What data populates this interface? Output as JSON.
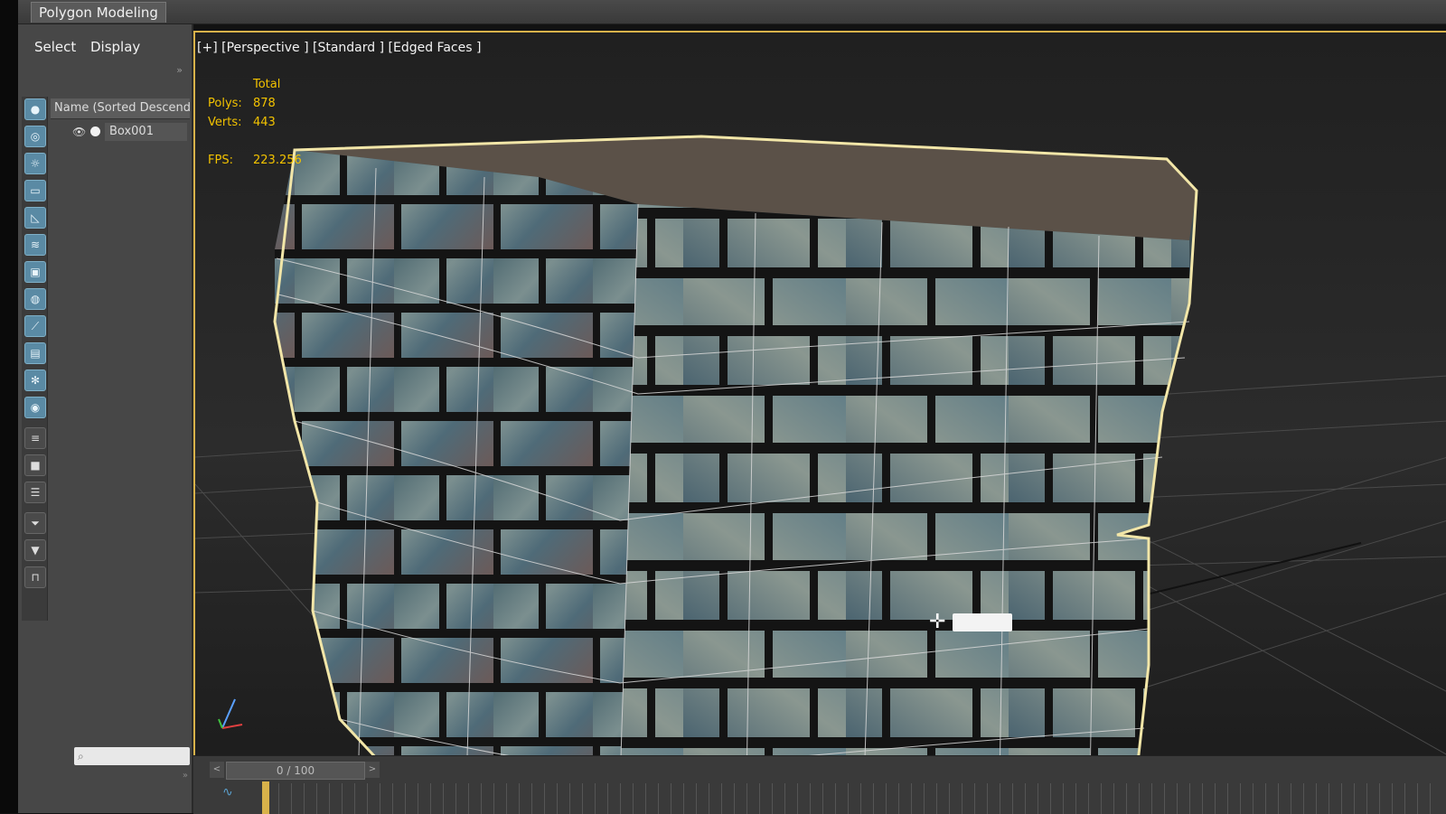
{
  "ribbon": {
    "active_tab": "Polygon Modeling"
  },
  "explorer": {
    "menu": [
      "Select",
      "Display"
    ],
    "collapse": "»",
    "column_header": "Name (Sorted Descendin",
    "objects": [
      {
        "name": "Box001",
        "visible": true
      }
    ],
    "footer_arrows": "»",
    "tool_icons": [
      "sphere-filter-icon",
      "geometry-icon",
      "light-icon",
      "camera-icon",
      "helper-icon",
      "spacewarp-icon",
      "group-icon",
      "xref-icon",
      "bone-icon",
      "container-icon",
      "frozen-icon",
      "hidden-icon",
      "list-icon",
      "select-all-icon",
      "properties-icon",
      "filter-icon",
      "funnel-icon",
      "layer-icon"
    ]
  },
  "viewport": {
    "label": "[+] [Perspective ] [Standard ] [Edged Faces ]",
    "stats": {
      "header": "Total",
      "polys_label": "Polys:",
      "polys": "878",
      "verts_label": "Verts:",
      "verts": "443",
      "fps_label": "FPS:",
      "fps": "223.256"
    },
    "selection_color": "#d8b24a"
  },
  "timeline": {
    "frame_display": "0 / 100",
    "prev": "<",
    "next": ">"
  }
}
